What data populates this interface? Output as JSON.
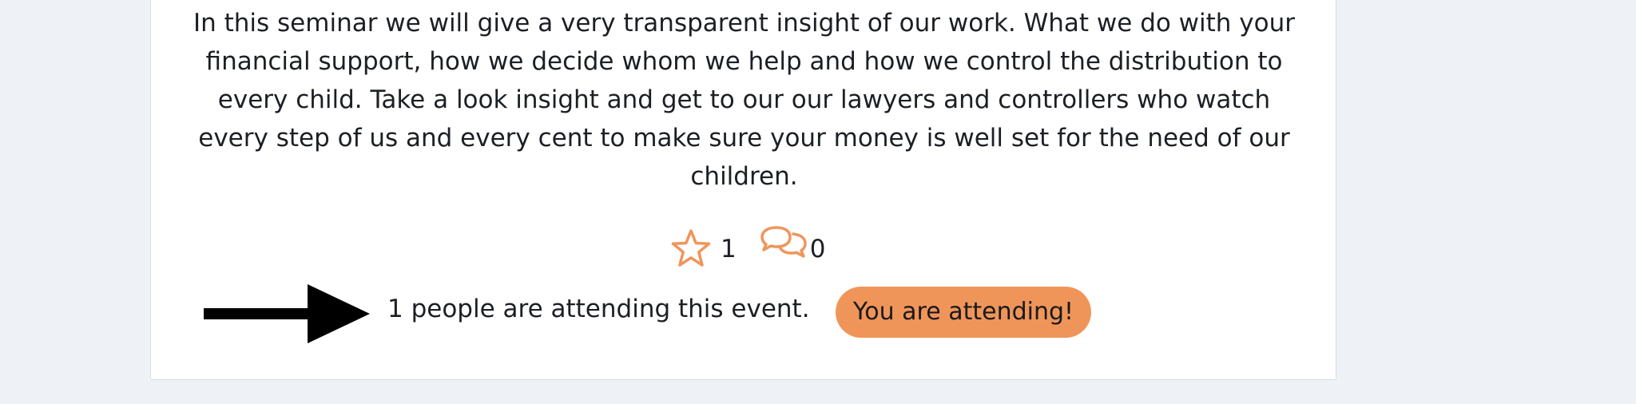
{
  "event": {
    "description": "In this seminar we will give a very transparent insight of our work. What we do with your financial support, how we decide whom we help and how we control the distribution to every child. Take a look insight and get to our our lawyers and controllers who watch every step of us and every cent to make sure your money is well set for the need of our children.",
    "stars_count": "1",
    "comments_count": "0",
    "attendance_text": "1 people are attending this event.",
    "attend_button_label": "You are attending!"
  },
  "icons": {
    "star": "star-icon",
    "comments": "comments-icon",
    "arrow": "arrow-right-icon"
  },
  "colors": {
    "accent": "#f0955a",
    "icon_orange": "#f0955a",
    "text": "#1c1f24",
    "page_background": "#eef2f7",
    "card_background": "#ffffff"
  }
}
